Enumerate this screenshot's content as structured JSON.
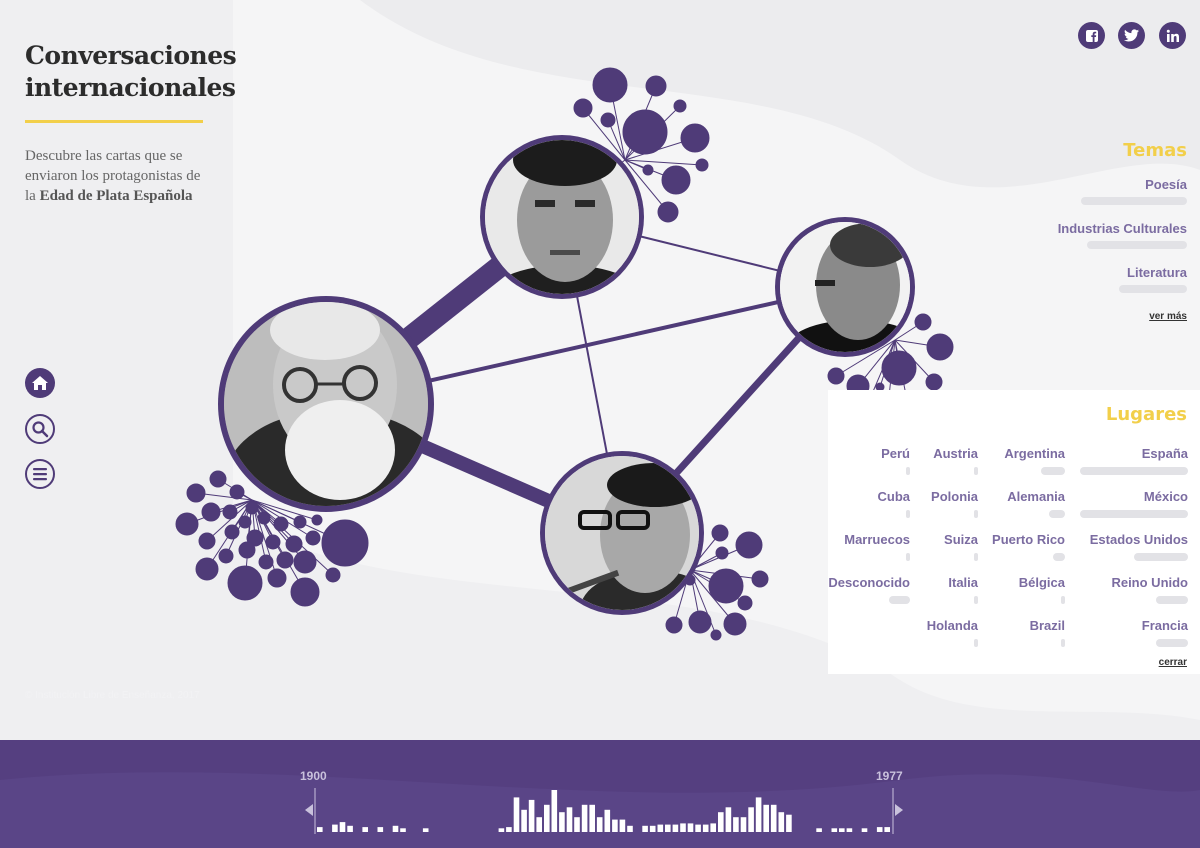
{
  "app": {
    "title_line1": "Conversaciones",
    "title_line2": "internacionales",
    "intro_prefix": "Descubre las cartas que se enviaron los protagonistas de la ",
    "intro_bold": "Edad de Plata Española",
    "copyright": "© Institución Libre de Enseñanza, 2017"
  },
  "nav": [
    {
      "name": "home-icon",
      "label": "home"
    },
    {
      "name": "search-icon",
      "label": "search"
    },
    {
      "name": "menu-icon",
      "label": "menu"
    }
  ],
  "social": [
    {
      "name": "facebook-icon",
      "glyph": "f"
    },
    {
      "name": "twitter-icon",
      "glyph": "t"
    },
    {
      "name": "linkedin-icon",
      "glyph": "in"
    }
  ],
  "temas": {
    "title": "Temas",
    "items": [
      {
        "label": "Poesía",
        "share": 0.53
      },
      {
        "label": "Industrias Culturales",
        "share": 0.5
      },
      {
        "label": "Literatura",
        "share": 0.34
      }
    ],
    "more": "ver más"
  },
  "lugares": {
    "title": "Lugares",
    "columns": [
      [
        {
          "label": "Perú",
          "share": 0.02
        },
        {
          "label": "Cuba",
          "share": 0.02
        },
        {
          "label": "Marruecos",
          "share": 0.02
        },
        {
          "label": "Desconocido",
          "share": 0.3
        }
      ],
      [
        {
          "label": "Austria",
          "share": 0.02
        },
        {
          "label": "Polonia",
          "share": 0.02
        },
        {
          "label": "Suiza",
          "share": 0.02
        },
        {
          "label": "Italia",
          "share": 0.02
        },
        {
          "label": "Holanda",
          "share": 0.02
        }
      ],
      [
        {
          "label": "Argentina",
          "share": 0.3
        },
        {
          "label": "Alemania",
          "share": 0.2
        },
        {
          "label": "Puerto Rico",
          "share": 0.15
        },
        {
          "label": "Bélgica",
          "share": 0.04
        },
        {
          "label": "Brazil",
          "share": 0.04
        }
      ],
      [
        {
          "label": "España",
          "share": 1.0
        },
        {
          "label": "México",
          "share": 1.0
        },
        {
          "label": "Estados Unidos",
          "share": 0.5
        },
        {
          "label": "Reino Unido",
          "share": 0.3
        },
        {
          "label": "Francia",
          "share": 0.3
        }
      ]
    ],
    "close": "cerrar"
  },
  "timeline": {
    "start_year": "1900",
    "end_year": "1977",
    "bars": [
      4,
      0,
      6,
      8,
      5,
      0,
      4,
      0,
      4,
      0,
      5,
      3,
      0,
      0,
      3,
      0,
      0,
      0,
      0,
      0,
      0,
      0,
      0,
      0,
      3,
      4,
      28,
      18,
      26,
      12,
      22,
      34,
      16,
      20,
      12,
      22,
      22,
      12,
      18,
      10,
      10,
      5,
      0,
      5,
      5,
      6,
      6,
      6,
      7,
      7,
      6,
      6,
      7,
      16,
      20,
      12,
      12,
      20,
      28,
      22,
      22,
      16,
      14,
      0,
      0,
      0,
      3,
      0,
      3,
      3,
      3,
      0,
      3,
      0,
      4,
      4
    ]
  },
  "colors": {
    "accent": "#f2cf4a",
    "purple": "#4f3b78",
    "timeline_bg": "#553f80",
    "label": "#7b6ca1"
  }
}
